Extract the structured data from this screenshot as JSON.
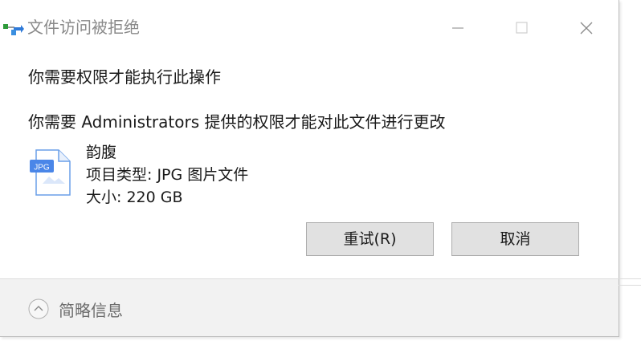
{
  "window": {
    "title": "文件访问被拒绝",
    "controls": {
      "minimize": "minimize-icon",
      "maximize": "maximize-icon",
      "close": "close-icon"
    }
  },
  "content": {
    "heading": "你需要权限才能执行此操作",
    "description": "你需要 Administrators 提供的权限才能对此文件进行更改",
    "file": {
      "icon": "jpg-file-icon",
      "icon_badge": "JPG",
      "name": "韵腹",
      "type": "项目类型: JPG 图片文件",
      "size": "大小: 220 GB"
    }
  },
  "buttons": {
    "retry": "重试(R)",
    "cancel": "取消"
  },
  "footer": {
    "details_label": "简略信息",
    "details_icon": "chevron-up-icon"
  },
  "colors": {
    "file_icon_blue": "#4a86e8",
    "button_bg": "#e1e1e1",
    "footer_bg": "#f2f2f2"
  }
}
